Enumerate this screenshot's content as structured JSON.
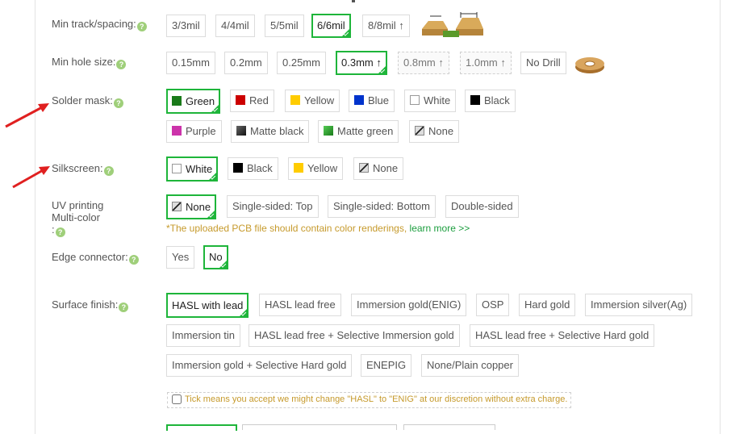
{
  "rows": {
    "track": {
      "label": "Min track/spacing:",
      "options": [
        "3/3mil",
        "4/4mil",
        "5/5mil",
        "6/6mil",
        "8/8mil ↑"
      ]
    },
    "hole": {
      "label": "Min hole size:",
      "options": [
        "0.15mm",
        "0.2mm",
        "0.25mm",
        "0.3mm ↑",
        "0.8mm ↑",
        "1.0mm ↑",
        "No Drill"
      ]
    },
    "mask": {
      "label": "Solder mask:",
      "options": [
        "Green",
        "Red",
        "Yellow",
        "Blue",
        "White",
        "Black",
        "Purple",
        "Matte black",
        "Matte green",
        "None"
      ]
    },
    "silk": {
      "label": "Silkscreen:",
      "options": [
        "White",
        "Black",
        "Yellow",
        "None"
      ]
    },
    "uv": {
      "label_line1": "UV printing",
      "label_line2": "Multi-color",
      "label_line3": ":",
      "options": [
        "None",
        "Single-sided: Top",
        "Single-sided: Bottom",
        "Double-sided"
      ],
      "note": "*The uploaded PCB file should contain color renderings,",
      "learn_more": "learn more >>"
    },
    "edge": {
      "label": "Edge connector:",
      "options": [
        "Yes",
        "No"
      ]
    },
    "surface": {
      "label": "Surface finish:",
      "options": [
        "HASL with lead",
        "HASL lead free",
        "Immersion gold(ENIG)",
        "OSP",
        "Hard gold",
        "Immersion silver(Ag)",
        "Immersion tin",
        "HASL lead free + Selective Immersion gold",
        "HASL lead free + Selective Hard gold",
        "Immersion gold + Selective Hard gold",
        "ENEPIG",
        "None/Plain copper"
      ],
      "disclaimer": "Tick means you accept we might change \"HASL\" to \"ENIG\" at our discretion without extra charge."
    }
  },
  "help_glyph": "?",
  "colors": {
    "selected_border": "#1eb53a",
    "arrow": "#e02020",
    "swatch_green": "#1a7a1a",
    "swatch_red": "#cc0000",
    "swatch_yellow": "#ffcc00",
    "swatch_blue": "#0033cc",
    "swatch_white": "#ffffff",
    "swatch_black": "#000000",
    "swatch_purple": "#cc33aa",
    "swatch_matte_black": "#333333",
    "swatch_matte_green": "#33aa33"
  },
  "icons": {
    "help": "help-circle-icon",
    "arrow": "red-arrow-icon",
    "trace": "pcb-trace-illustration",
    "hole": "drill-hole-illustration",
    "none": "none-slash-swatch"
  }
}
